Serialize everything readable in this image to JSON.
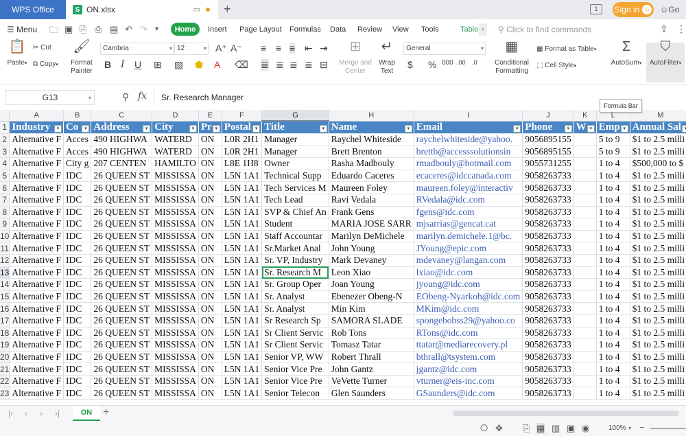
{
  "titlebar": {
    "app_name": "WPS Office",
    "file_name": "ON.xlsx",
    "file_icon": "S",
    "sign_in": "Sign in",
    "goto": "Go"
  },
  "menu": {
    "menu_label": "Menu",
    "tabs": [
      "Home",
      "Insert",
      "Page Layout",
      "Formulas",
      "Data",
      "Review",
      "View",
      "Tools"
    ],
    "active_tab": "Home",
    "context_tab": "Table",
    "search_placeholder": "Click to find commands"
  },
  "ribbon": {
    "paste": "Paste",
    "cut": "Cut",
    "copy": "Copy",
    "format_painter_1": "Format",
    "format_painter_2": "Painter",
    "font_name": "Cambria",
    "font_size": "12",
    "merge_center_1": "Merge and",
    "merge_center_2": "Center",
    "wrap_text_1": "Wrap",
    "wrap_text_2": "Text",
    "number_format": "General",
    "conditional_1": "Conditional",
    "conditional_2": "Formatting",
    "format_as_table": "Format as Table",
    "cell_style": "Cell Style",
    "autosum": "AutoSum",
    "autofilter": "AutoFilter"
  },
  "formula_bar": {
    "cell_ref": "G13",
    "fx": "fx",
    "content": "Sr. Research Manager",
    "tooltip": "Formula Bar"
  },
  "grid": {
    "columns": [
      "A",
      "B",
      "C",
      "D",
      "E",
      "F",
      "G",
      "H",
      "I",
      "J",
      "K",
      "L",
      "M"
    ],
    "active_column": "G",
    "active_row": 13,
    "headers": [
      "Industry",
      "Co",
      "Address",
      "City",
      "Pr",
      "Postal",
      "Title",
      "Name",
      "Email",
      "Phone",
      "W",
      "Emp",
      "Annual Sal"
    ],
    "rows": [
      [
        "Alternative F",
        "Acces",
        "490 HIGHWA",
        "WATERD",
        "ON",
        "L0R 2H1",
        "Manager",
        "Raychel Whiteside",
        "raychelwhiteside@yahoo.",
        "9056895155",
        "",
        "5 to 9",
        "$1 to 2.5 milli"
      ],
      [
        "Alternative F",
        "Acces",
        "490 HIGHWA",
        "WATERD",
        "ON",
        "L0R 2H1",
        "Manager",
        "Brett Brenton",
        "brettb@accesssolutionsin",
        "9056895155",
        "",
        "5 to 9",
        "$1 to 2.5 milli"
      ],
      [
        "Alternative F",
        "City g",
        "207 CENTEN",
        "HAMILTO",
        "ON",
        "L8E 1H8",
        "Owner",
        "Rasha Madbouly",
        "rmadbouly@hotmail.com",
        "9055731255",
        "",
        "1 to 4",
        "$500,000 to $"
      ],
      [
        "Alternative F",
        "IDC",
        "26 QUEEN ST",
        "MISSISSA",
        "ON",
        "L5N 1A1",
        "Technical Supp",
        "Eduardo Caceres",
        "ecaceres@idccanada.com",
        "9058263733",
        "",
        "1 to 4",
        "$1 to 2.5 milli"
      ],
      [
        "Alternative F",
        "IDC",
        "26 QUEEN ST",
        "MISSISSA",
        "ON",
        "L5N 1A1",
        "Tech Services M",
        "Maureen Foley",
        "maureen.foley@interactiv",
        "9058263733",
        "",
        "1 to 4",
        "$1 to 2.5 milli"
      ],
      [
        "Alternative F",
        "IDC",
        "26 QUEEN ST",
        "MISSISSA",
        "ON",
        "L5N 1A1",
        "Tech Lead",
        "Ravi Vedala",
        "RVedala@idc.com",
        "9058263733",
        "",
        "1 to 4",
        "$1 to 2.5 milli"
      ],
      [
        "Alternative F",
        "IDC",
        "26 QUEEN ST",
        "MISSISSA",
        "ON",
        "L5N 1A1",
        "SVP & Chief An",
        "Frank Gens",
        "fgens@idc.com",
        "9058263733",
        "",
        "1 to 4",
        "$1 to 2.5 milli"
      ],
      [
        "Alternative F",
        "IDC",
        "26 QUEEN ST",
        "MISSISSA",
        "ON",
        "L5N 1A1",
        "Student",
        "MARIA  JOSE SARR",
        "mjsarrias@gencat.cat",
        "9058263733",
        "",
        "1 to 4",
        "$1 to 2.5 milli"
      ],
      [
        "Alternative F",
        "IDC",
        "26 QUEEN ST",
        "MISSISSA",
        "ON",
        "L5N 1A1",
        "Staff Accountar",
        "Marilyn DeMichele",
        "marilyn.demichele.1@bc.",
        "9058263733",
        "",
        "1 to 4",
        "$1 to 2.5 milli"
      ],
      [
        "Alternative F",
        "IDC",
        "26 QUEEN ST",
        "MISSISSA",
        "ON",
        "L5N 1A1",
        "Sr.Market Anal",
        "John Young",
        "JYoung@epic.com",
        "9058263733",
        "",
        "1 to 4",
        "$1 to 2.5 milli"
      ],
      [
        "Alternative F",
        "IDC",
        "26 QUEEN ST",
        "MISSISSA",
        "ON",
        "L5N 1A1",
        "Sr. VP, Industry",
        "Mark Devaney",
        "mdevaney@langan.com",
        "9058263733",
        "",
        "1 to 4",
        "$1 to 2.5 milli"
      ],
      [
        "Alternative F",
        "IDC",
        "26 QUEEN ST",
        "MISSISSA",
        "ON",
        "L5N 1A1",
        "Sr. Research M",
        "Leon Xiao",
        "lxiao@idc.com",
        "9058263733",
        "",
        "1 to 4",
        "$1 to 2.5 milli"
      ],
      [
        "Alternative F",
        "IDC",
        "26 QUEEN ST",
        "MISSISSA",
        "ON",
        "L5N 1A1",
        "Sr. Group Oper",
        "Joan Young",
        "jyoung@idc.com",
        "9058263733",
        "",
        "1 to 4",
        "$1 to 2.5 milli"
      ],
      [
        "Alternative F",
        "IDC",
        "26 QUEEN ST",
        "MISSISSA",
        "ON",
        "L5N 1A1",
        "Sr. Analyst",
        "Ebenezer Obeng-N",
        "EObeng-Nyarkoh@idc.com",
        "9058263733",
        "",
        "1 to 4",
        "$1 to 2.5 milli"
      ],
      [
        "Alternative F",
        "IDC",
        "26 QUEEN ST",
        "MISSISSA",
        "ON",
        "L5N 1A1",
        "Sr. Analyst",
        "Min Kim",
        "MKim@idc.com",
        "9058263733",
        "",
        "1 to 4",
        "$1 to 2.5 milli"
      ],
      [
        "Alternative F",
        "IDC",
        "26 QUEEN ST",
        "MISSISSA",
        "ON",
        "L5N 1A1",
        "Sr Research Sp",
        "SAMORA SLADE",
        "spongebobss29@yahoo.co",
        "9058263733",
        "",
        "1 to 4",
        "$1 to 2.5 milli"
      ],
      [
        "Alternative F",
        "IDC",
        "26 QUEEN ST",
        "MISSISSA",
        "ON",
        "L5N 1A1",
        "Sr Client Servic",
        "Rob Tons",
        "RTons@idc.com",
        "9058263733",
        "",
        "1 to 4",
        "$1 to 2.5 milli"
      ],
      [
        "Alternative F",
        "IDC",
        "26 QUEEN ST",
        "MISSISSA",
        "ON",
        "L5N 1A1",
        "Sr Client Servic",
        "Tomasz Tatar",
        "ttatar@mediarecovery.pl",
        "9058263733",
        "",
        "1 to 4",
        "$1 to 2.5 milli"
      ],
      [
        "Alternative F",
        "IDC",
        "26 QUEEN ST",
        "MISSISSA",
        "ON",
        "L5N 1A1",
        "Senior VP, WW",
        "Robert Thrall",
        "bthrall@tsystem.com",
        "9058263733",
        "",
        "1 to 4",
        "$1 to 2.5 milli"
      ],
      [
        "Alternative F",
        "IDC",
        "26 QUEEN ST",
        "MISSISSA",
        "ON",
        "L5N 1A1",
        "Senior Vice Pre",
        "John Gantz",
        "jgantz@idc.com",
        "9058263733",
        "",
        "1 to 4",
        "$1 to 2.5 milli"
      ],
      [
        "Alternative F",
        "IDC",
        "26 QUEEN ST",
        "MISSISSA",
        "ON",
        "L5N 1A1",
        "Senior Vice Pre",
        "VeVette Turner",
        "vturner@eis-inc.com",
        "9058263733",
        "",
        "1 to 4",
        "$1 to 2.5 milli"
      ],
      [
        "Alternative F",
        "IDC",
        "26 QUEEN ST",
        "MISSISSA",
        "ON",
        "L5N 1A1",
        "Senior Telecon",
        "Glen Saunders",
        "GSaunders@idc.com",
        "9058263733",
        "",
        "1 to 4",
        "$1 to 2.5 milli"
      ]
    ]
  },
  "sheets": {
    "active": "ON"
  },
  "status": {
    "zoom": "100%"
  },
  "colors": {
    "header_fill": "#4a86c5",
    "accent_green": "#22a34a",
    "wps_blue": "#3d74c5",
    "signin_orange": "#f4a431"
  }
}
